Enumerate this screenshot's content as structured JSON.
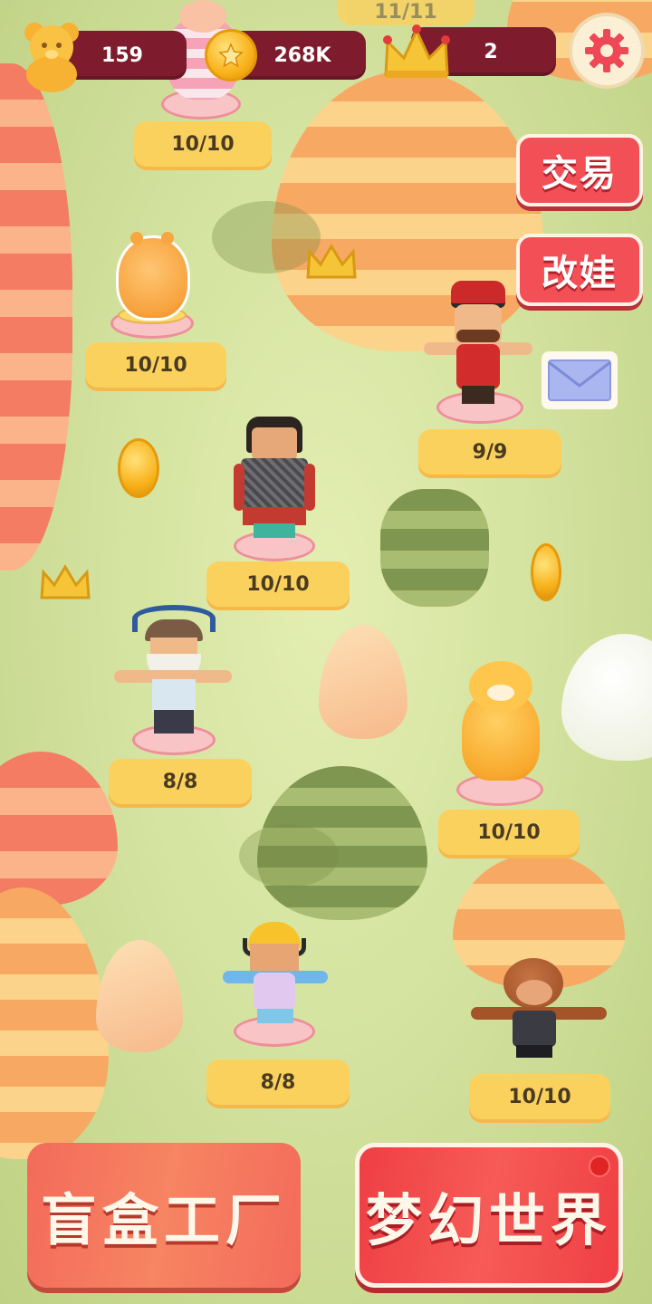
{
  "hud": {
    "bears": "159",
    "coins": "268K",
    "crowns": "2",
    "progress_top": "11/11"
  },
  "side_buttons": {
    "trade": "交易",
    "modify": "改娃"
  },
  "figures": [
    {
      "name": "pink-bunny",
      "count": "10/10"
    },
    {
      "name": "orange-blob",
      "count": "10/10"
    },
    {
      "name": "mustache-guard",
      "count": "9/9"
    },
    {
      "name": "armored-warrior",
      "count": "10/10"
    },
    {
      "name": "viking",
      "count": "8/8"
    },
    {
      "name": "yellow-cat",
      "count": "10/10"
    },
    {
      "name": "headphone-kid",
      "count": "8/8"
    },
    {
      "name": "monkey",
      "count": "10/10"
    }
  ],
  "bottom_buttons": {
    "factory": "盲盒工厂",
    "dream": "梦幻世界"
  },
  "colors": {
    "hud_pill": "#7e1c2e",
    "red_button": "#f25056",
    "label_yellow": "#fbd15e"
  }
}
